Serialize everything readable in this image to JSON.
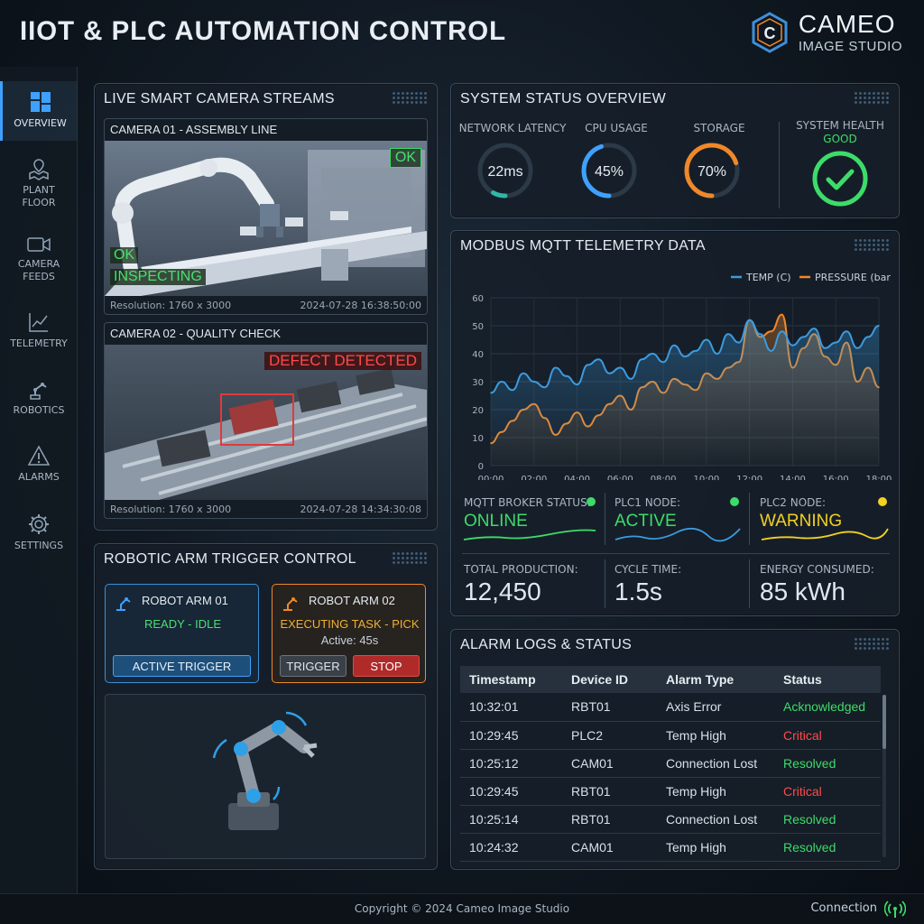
{
  "header": {
    "title": "IIOT & PLC AUTOMATION CONTROL",
    "logo_main": "CAMEO",
    "logo_sub": "IMAGE STUDIO",
    "logo_letter": "C"
  },
  "sidebar": {
    "items": [
      {
        "label": "OVERVIEW",
        "icon": "dashboard-icon",
        "active": true
      },
      {
        "label": "PLANT FLOOR",
        "icon": "map-pin-icon"
      },
      {
        "label": "CAMERA FEEDS",
        "icon": "video-camera-icon"
      },
      {
        "label": "TELEMETRY",
        "icon": "line-chart-icon"
      },
      {
        "label": "ROBOTICS",
        "icon": "robot-arm-icon"
      },
      {
        "label": "ALARMS",
        "icon": "warning-icon"
      },
      {
        "label": "SETTINGS",
        "icon": "gear-icon"
      }
    ]
  },
  "cameras": {
    "title": "LIVE SMART CAMERA STREAMS",
    "cam1": {
      "title": "CAMERA 01 - ASSEMBLY LINE",
      "badge_ok_top": "OK",
      "badge_ok": "OK",
      "badge_inspecting": "INSPECTING",
      "resolution": "Resolution: 1760 x 3000",
      "timestamp": "2024-07-28 16:38:50:00"
    },
    "cam2": {
      "title": "CAMERA 02 - QUALITY CHECK",
      "badge_defect": "DEFECT DETECTED",
      "resolution": "Resolution: 1760 x 3000",
      "timestamp": "2024-07-28 14:34:30:08"
    }
  },
  "robot": {
    "title": "ROBOTIC ARM TRIGGER CONTROL",
    "arm1": {
      "name": "ROBOT ARM 01",
      "state": "READY - IDLE",
      "button": "ACTIVE TRIGGER"
    },
    "arm2": {
      "name": "ROBOT ARM 02",
      "state": "EXECUTING TASK - PICK",
      "active": "Active: 45s",
      "trigger": "TRIGGER",
      "stop": "STOP"
    }
  },
  "system": {
    "title": "SYSTEM STATUS OVERVIEW",
    "latency": {
      "label": "NETWORK LATENCY",
      "value": "22ms",
      "fraction": 0.08
    },
    "cpu": {
      "label": "CPU USAGE",
      "value": "45%",
      "fraction": 0.45
    },
    "storage": {
      "label": "STORAGE",
      "value": "70%",
      "fraction": 0.7
    },
    "health": {
      "label": "SYSTEM HEALTH",
      "value": "GOOD"
    }
  },
  "telemetry": {
    "title": "MODBUS MQTT TELEMETRY DATA",
    "broker": {
      "label": "MQTT BROKER STATUS:",
      "value": "ONLINE"
    },
    "plc1": {
      "label": "PLC1 NODE:",
      "value": "ACTIVE"
    },
    "plc2": {
      "label": "PLC2 NODE:",
      "value": "WARNING"
    },
    "production": {
      "label": "TOTAL PRODUCTION:",
      "value": "12,450"
    },
    "cycle": {
      "label": "CYCLE TIME:",
      "value": "1.5s"
    },
    "energy": {
      "label": "ENERGY CONSUMED:",
      "value": "85 kWh"
    }
  },
  "chart_data": {
    "type": "line",
    "x": [
      "00:00",
      "00:30",
      "01:00",
      "01:30",
      "02:00",
      "02:30",
      "03:00",
      "03:30",
      "04:00",
      "04:30",
      "05:00",
      "05:30",
      "06:00",
      "06:30",
      "07:00",
      "07:30",
      "08:00",
      "08:30",
      "09:00",
      "09:30",
      "10:00",
      "10:30",
      "11:00",
      "11:30",
      "12:00",
      "12:30",
      "13:00",
      "13:30",
      "14:00",
      "14:30",
      "15:00",
      "15:30",
      "16:00",
      "16:30",
      "17:00",
      "17:30",
      "18:00"
    ],
    "xticks": [
      "00:00",
      "02:00",
      "04:00",
      "06:00",
      "08:00",
      "10:00",
      "12:00",
      "14:00",
      "16:00",
      "18:00"
    ],
    "yticks": [
      0,
      10,
      20,
      30,
      40,
      50,
      60
    ],
    "ylim": [
      0,
      60
    ],
    "series": [
      {
        "name": "TEMP (C)",
        "color": "#3b9be0",
        "values": [
          26,
          30,
          27,
          33,
          30,
          28,
          35,
          32,
          29,
          36,
          38,
          33,
          35,
          31,
          38,
          40,
          37,
          43,
          39,
          41,
          45,
          40,
          47,
          44,
          52,
          47,
          41,
          48,
          43,
          46,
          49,
          42,
          44,
          48,
          42,
          46,
          50
        ]
      },
      {
        "name": "PRESSURE (bar)",
        "color": "#f0882a",
        "values": [
          8,
          12,
          16,
          20,
          22,
          17,
          11,
          15,
          19,
          14,
          18,
          22,
          25,
          20,
          28,
          30,
          26,
          31,
          29,
          27,
          33,
          31,
          35,
          37,
          52,
          46,
          48,
          54,
          35,
          42,
          47,
          39,
          36,
          44,
          30,
          35,
          28
        ]
      }
    ]
  },
  "alarms": {
    "title": "ALARM LOGS & STATUS",
    "headers": [
      "Timestamp",
      "Device ID",
      "Alarm Type",
      "Status"
    ],
    "rows": [
      [
        "10:32:01",
        "RBT01",
        "Axis Error",
        "Acknowledged"
      ],
      [
        "10:29:45",
        "PLC2",
        "Temp High",
        "Critical"
      ],
      [
        "10:25:12",
        "CAM01",
        "Connection Lost",
        "Resolved"
      ],
      [
        "10:29:45",
        "RBT01",
        "Temp High",
        "Critical"
      ],
      [
        "10:25:14",
        "RBT01",
        "Connection Lost",
        "Resolved"
      ],
      [
        "10:24:32",
        "CAM01",
        "Temp High",
        "Resolved"
      ]
    ]
  },
  "footer": {
    "copyright": "Copyright © 2024 Cameo Image Studio",
    "connection": "Connection"
  },
  "colors": {
    "accent": "#3ea1ff",
    "ok": "#3ddc6a",
    "warn": "#f2d024",
    "danger": "#ff4a4a",
    "orange": "#f0882a"
  }
}
